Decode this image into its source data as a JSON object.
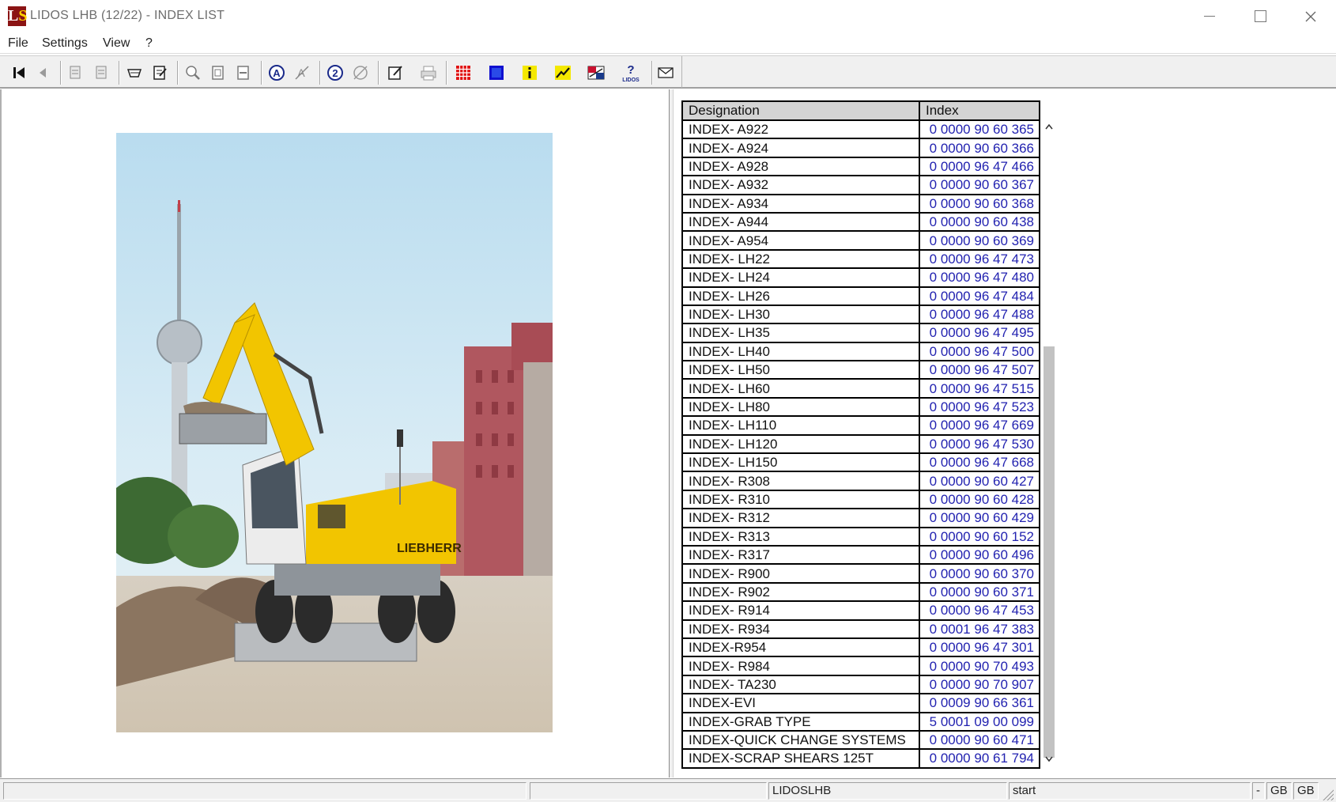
{
  "window": {
    "title": "LIDOS LHB (12/22) - INDEX LIST",
    "logo": "LS"
  },
  "menu": [
    "File",
    "Settings",
    "View",
    "?"
  ],
  "toolbar_icons": [
    "first-page-icon",
    "previous-page-icon",
    "back-document-icon",
    "forward-document-icon",
    "basket-icon",
    "order-list-icon",
    "zoom-in-icon",
    "fit-page-icon",
    "fit-width-icon",
    "search-text-icon",
    "search-clear-icon",
    "search-number-icon",
    "search-number-clear-icon",
    "edit-note-icon",
    "print-icon",
    "grid-icon",
    "blue-square-icon",
    "info-icon",
    "settings-tool-icon",
    "language-icon",
    "lidos-help-icon",
    "mail-icon"
  ],
  "table": {
    "headers": {
      "designation": "Designation",
      "index": "Index"
    },
    "rows": [
      {
        "designation": "INDEX- A922",
        "index": "0 0000 90 60 365"
      },
      {
        "designation": "INDEX- A924",
        "index": "0 0000 90 60 366"
      },
      {
        "designation": "INDEX- A928",
        "index": "0 0000 96 47 466"
      },
      {
        "designation": "INDEX- A932",
        "index": "0 0000 90 60 367"
      },
      {
        "designation": "INDEX- A934",
        "index": "0 0000 90 60 368"
      },
      {
        "designation": "INDEX- A944",
        "index": "0 0000 90 60 438"
      },
      {
        "designation": "INDEX- A954",
        "index": "0 0000 90 60 369"
      },
      {
        "designation": "INDEX- LH22",
        "index": "0 0000 96 47 473"
      },
      {
        "designation": "INDEX- LH24",
        "index": "0 0000 96 47 480"
      },
      {
        "designation": "INDEX- LH26",
        "index": "0 0000 96 47 484"
      },
      {
        "designation": "INDEX- LH30",
        "index": "0 0000 96 47 488"
      },
      {
        "designation": "INDEX- LH35",
        "index": "0 0000 96 47 495"
      },
      {
        "designation": "INDEX- LH40",
        "index": "0 0000 96 47 500"
      },
      {
        "designation": "INDEX- LH50",
        "index": "0 0000 96 47 507"
      },
      {
        "designation": "INDEX- LH60",
        "index": "0 0000 96 47 515"
      },
      {
        "designation": "INDEX- LH80",
        "index": "0 0000 96 47 523"
      },
      {
        "designation": "INDEX- LH110",
        "index": "0 0000 96 47 669"
      },
      {
        "designation": "INDEX- LH120",
        "index": "0 0000 96 47 530"
      },
      {
        "designation": "INDEX- LH150",
        "index": "0 0000 96 47 668"
      },
      {
        "designation": "INDEX- R308",
        "index": "0 0000 90 60 427"
      },
      {
        "designation": "INDEX- R310",
        "index": "0 0000 90 60 428"
      },
      {
        "designation": "INDEX- R312",
        "index": "0 0000 90 60 429"
      },
      {
        "designation": "INDEX- R313",
        "index": "0 0000 90 60 152"
      },
      {
        "designation": "INDEX- R317",
        "index": "0 0000 90 60 496"
      },
      {
        "designation": "INDEX- R900",
        "index": "0 0000 90 60 370"
      },
      {
        "designation": "INDEX- R902",
        "index": "0 0000 90 60 371"
      },
      {
        "designation": "INDEX- R914",
        "index": "0 0000 96 47 453"
      },
      {
        "designation": "INDEX- R934",
        "index": "0 0001 96 47 383"
      },
      {
        "designation": "INDEX-R954",
        "index": "0 0000 96 47 301"
      },
      {
        "designation": "INDEX- R984",
        "index": "0 0000 90 70 493"
      },
      {
        "designation": "INDEX- TA230",
        "index": "0 0000 90 70 907"
      },
      {
        "designation": "INDEX-EVI",
        "index": "0 0009 90 66 361"
      },
      {
        "designation": "INDEX-GRAB TYPE",
        "index": "5 0001 09 00 099"
      },
      {
        "designation": "INDEX-QUICK CHANGE SYSTEMS",
        "index": "0 0000 90 60 471"
      },
      {
        "designation": "INDEX-SCRAP SHEARS 125T",
        "index": "0 0000 90 61 794"
      }
    ]
  },
  "image": {
    "subject": "wheeled-excavator-photo",
    "brand_text": "LIEBHERR"
  },
  "statusbar": {
    "cell1": "",
    "cell2": "",
    "cell3": "LIDOSLHB",
    "cell4": "start",
    "cell5": "-",
    "cell6": "GB",
    "cell7": "GB"
  },
  "colors": {
    "index_text": "#2222b0",
    "header_bg": "#d4d4d4",
    "machine_yellow": "#f2c500"
  }
}
